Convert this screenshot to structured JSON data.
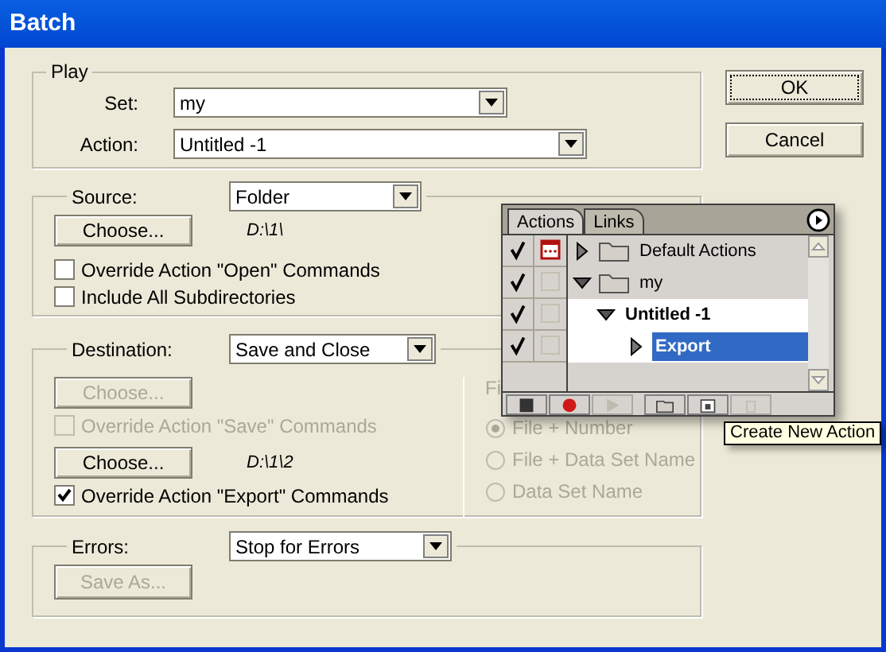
{
  "window": {
    "title": "Batch"
  },
  "play": {
    "label": "Play",
    "set": {
      "label": "Set:",
      "value": "my"
    },
    "action": {
      "label": "Action:",
      "value": "Untitled -1"
    }
  },
  "buttons": [
    {
      "label": "OK",
      "focused": true
    },
    {
      "label": "Cancel",
      "focused": false
    }
  ],
  "source": {
    "label": "Source:",
    "value": "Folder",
    "choose": {
      "label": "Choose...",
      "disabled": false
    },
    "path": "D:\\1\\",
    "checkboxes": [
      {
        "label": "Override Action \"Open\" Commands",
        "checked": false,
        "disabled": false
      },
      {
        "label": "Include All Subdirectories",
        "checked": false,
        "disabled": false
      }
    ]
  },
  "destination": {
    "label": "Destination:",
    "value": "Save and Close",
    "controls": [
      {
        "kind": "button",
        "label": "Choose...",
        "disabled": true
      },
      {
        "kind": "checkbox",
        "label": "Override Action \"Save\" Commands",
        "checked": false,
        "disabled": true
      },
      {
        "kind": "button",
        "label": "Choose...",
        "disabled": false,
        "path": "D:\\1\\2"
      },
      {
        "kind": "checkbox",
        "label": "Override Action \"Export\" Commands",
        "checked": true,
        "disabled": false
      }
    ],
    "file_naming": {
      "heading": "Fi",
      "options": [
        {
          "label": "File + Number",
          "selected": true,
          "disabled": true
        },
        {
          "label": "File + Data Set Name",
          "selected": false,
          "disabled": true
        },
        {
          "label": "Data Set Name",
          "selected": false,
          "disabled": true
        }
      ]
    }
  },
  "errors": {
    "label": "Errors:",
    "value": "Stop for Errors",
    "save_as": {
      "label": "Save As...",
      "disabled": true
    }
  },
  "actions_panel": {
    "tabs": [
      {
        "label": "Actions",
        "selected": true
      },
      {
        "label": "Links",
        "selected": false
      }
    ],
    "tree": [
      {
        "kind": "set",
        "label": "Default Actions",
        "checked": true,
        "dialog": true,
        "expanded": false,
        "selected": false
      },
      {
        "kind": "set",
        "label": "my",
        "checked": true,
        "dialog": false,
        "expanded": true,
        "selected": false,
        "children": [
          {
            "kind": "action",
            "label": "Untitled -1",
            "checked": true,
            "dialog": false,
            "expanded": true,
            "selected": false,
            "children": [
              {
                "kind": "command",
                "label": "Export",
                "checked": true,
                "dialog": false,
                "expanded": false,
                "selected": true
              }
            ]
          }
        ]
      }
    ],
    "toolbar": [
      {
        "kind": "stop",
        "disabled": false
      },
      {
        "kind": "record",
        "disabled": false
      },
      {
        "kind": "play",
        "disabled": true
      },
      {
        "kind": "new_set",
        "disabled": false
      },
      {
        "kind": "new_action",
        "disabled": false
      },
      {
        "kind": "delete",
        "disabled": true
      }
    ],
    "tooltip": "Create New Action"
  }
}
